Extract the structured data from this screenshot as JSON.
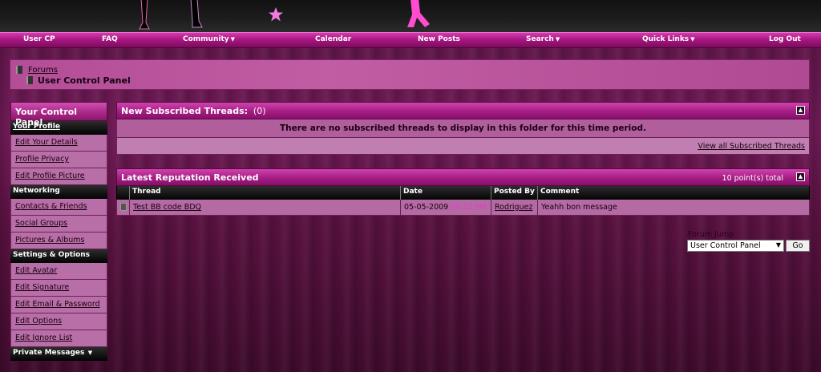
{
  "navbar": {
    "items": [
      "User CP",
      "FAQ",
      "Community",
      "Calendar",
      "New Posts",
      "Search",
      "Quick Links",
      "Log Out"
    ]
  },
  "breadcrumb": {
    "root": "Forums",
    "current": "User Control Panel"
  },
  "sidebar": {
    "title": "Your Control Panel",
    "sections": [
      {
        "label": "Your Profile",
        "links": [
          "Edit Your Details",
          "Profile Privacy",
          "Edit Profile Picture"
        ]
      },
      {
        "label": "Networking",
        "links": [
          "Contacts & Friends",
          "Social Groups",
          "Pictures & Albums"
        ]
      },
      {
        "label": "Settings & Options",
        "links": [
          "Edit Avatar",
          "Edit Signature",
          "Edit Email & Password",
          "Edit Options",
          "Edit Ignore List"
        ]
      },
      {
        "label": "Private Messages",
        "links": []
      }
    ]
  },
  "subscribed": {
    "title": "New Subscribed Threads:",
    "count": "(0)",
    "empty_message": "There are no subscribed threads to display in this folder for this time period.",
    "view_all": "View all Subscribed Threads"
  },
  "reputation": {
    "title": "Latest Reputation Received",
    "total": "10 point(s) total",
    "columns": [
      "Thread",
      "Date",
      "Posted By",
      "Comment"
    ],
    "rows": [
      {
        "thread": "Test BB code BDQ",
        "date": "05-05-2009",
        "time": "09:12 PM",
        "posted_by": "Rodriguez",
        "comment": "Yeahh bon message"
      }
    ]
  },
  "forum_jump": {
    "label": "Forum Jump",
    "selected": "User Control Panel",
    "go": "Go"
  },
  "colors": {
    "accent": "#a51d83",
    "time_text": "#e040c8"
  }
}
